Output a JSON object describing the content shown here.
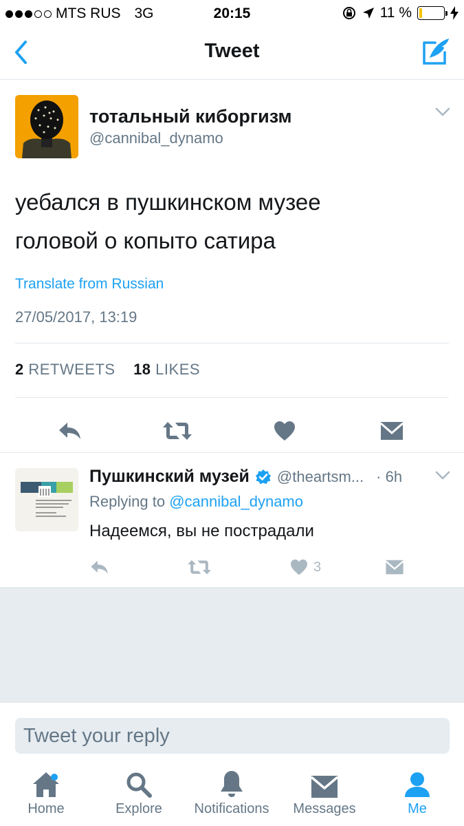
{
  "status_bar": {
    "carrier": "MTS RUS",
    "network": "3G",
    "time": "20:15",
    "battery_percent": "11 %",
    "battery_level": 0.11,
    "signal_dots_filled": 3,
    "signal_dots_total": 5
  },
  "nav": {
    "title": "Tweet",
    "back_icon": "chevron-left-icon",
    "compose_icon": "compose-tweet-icon"
  },
  "tweet": {
    "author_name": "тотальный киборгизм",
    "author_handle": "@cannibal_dynamo",
    "text_line1": "уебался в пушкинском музее",
    "text_line2": "головой о копыто сатира",
    "translate_label": "Translate from Russian",
    "timestamp": "27/05/2017, 13:19",
    "retweet_count": "2",
    "retweet_label": "RETWEETS",
    "like_count": "18",
    "like_label": "LIKES"
  },
  "reply": {
    "author_name": "Пушкинский музей",
    "author_handle": "@theartsm...",
    "time": "· 6h",
    "replying_prefix": "Replying to",
    "replying_to": "@cannibal_dynamo",
    "text": "Надеемся, вы не пострадали",
    "like_count": "3",
    "verified": true
  },
  "composer": {
    "placeholder": "Tweet your reply"
  },
  "tabs": [
    {
      "label": "Home",
      "icon": "home-icon",
      "active": false,
      "has_badge": true
    },
    {
      "label": "Explore",
      "icon": "search-icon",
      "active": false
    },
    {
      "label": "Notifications",
      "icon": "bell-icon",
      "active": false
    },
    {
      "label": "Messages",
      "icon": "envelope-icon",
      "active": false
    },
    {
      "label": "Me",
      "icon": "person-icon",
      "active": true
    }
  ],
  "colors": {
    "accent": "#1da1f2",
    "text": "#14171a",
    "muted": "#657786",
    "icon_gray": "#657786",
    "reply_icon_gray": "#aab8c2",
    "divider": "#e1e8ed",
    "background_gray": "#e6ecf0"
  }
}
